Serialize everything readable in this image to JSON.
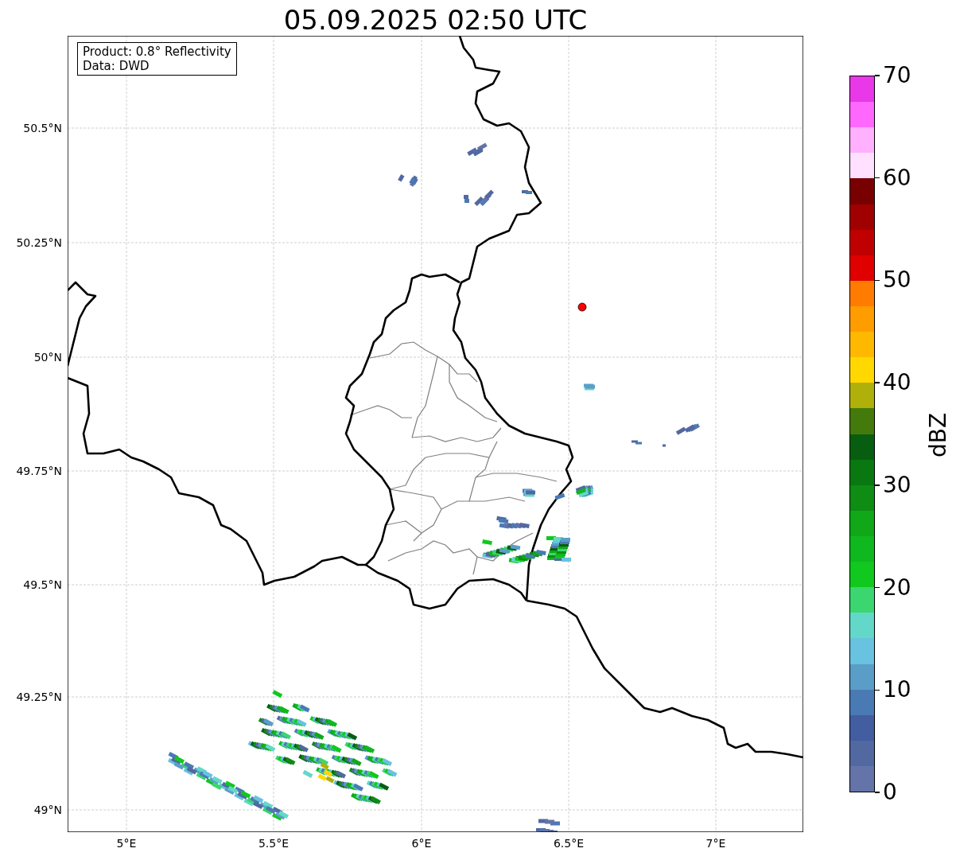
{
  "title": "05.09.2025 02:50 UTC",
  "info_box": {
    "lines": [
      "Product: 0.8° Reflectivity",
      "Data: DWD"
    ]
  },
  "map": {
    "x_ticks": [
      "5°E",
      "5.5°E",
      "6°E",
      "6.5°E",
      "7°E"
    ],
    "y_ticks": [
      "50.5°N",
      "50.25°N",
      "50°N",
      "49.75°N",
      "49.5°N",
      "49.25°N",
      "49°N"
    ]
  },
  "colorbar": {
    "label": "dBZ",
    "ticks": [
      "70",
      "60",
      "50",
      "40",
      "30",
      "20",
      "10",
      "0"
    ],
    "bands": [
      {
        "color": "#e838e8"
      },
      {
        "color": "#ff68ff"
      },
      {
        "color": "#ffb0ff"
      },
      {
        "color": "#ffe0ff"
      },
      {
        "color": "#780000"
      },
      {
        "color": "#a00000"
      },
      {
        "color": "#c00000"
      },
      {
        "color": "#e00000"
      },
      {
        "color": "#ff7c00"
      },
      {
        "color": "#ff9c00"
      },
      {
        "color": "#ffb800"
      },
      {
        "color": "#ffd800"
      },
      {
        "color": "#b0b00a"
      },
      {
        "color": "#447a0c"
      },
      {
        "color": "#085e10"
      },
      {
        "color": "#0a7810"
      },
      {
        "color": "#0e8c14"
      },
      {
        "color": "#10a818"
      },
      {
        "color": "#10b820"
      },
      {
        "color": "#10c81e"
      },
      {
        "color": "#3cd670"
      },
      {
        "color": "#64d8c8"
      },
      {
        "color": "#68c2e0"
      },
      {
        "color": "#5a9ec8"
      },
      {
        "color": "#4a7ab4"
      },
      {
        "color": "#425da0"
      },
      {
        "color": "#5268a0"
      },
      {
        "color": "#6474a8"
      }
    ]
  }
}
